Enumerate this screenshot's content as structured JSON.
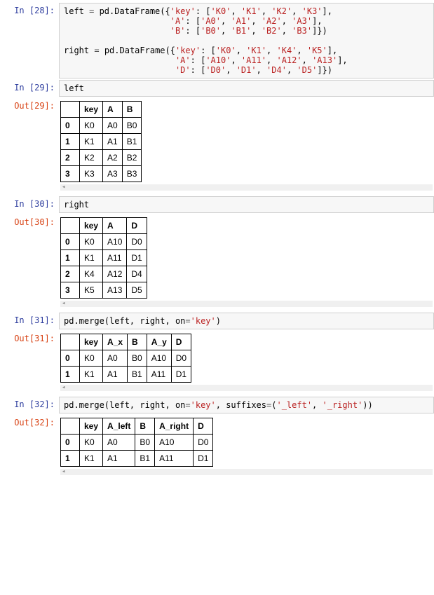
{
  "cells": [
    {
      "type": "code",
      "in_prompt": "In  [28]:",
      "code_html": "left <span class='op'>=</span> pd.DataFrame({<span class='s'>'key'</span>: [<span class='s'>'K0'</span>, <span class='s'>'K1'</span>, <span class='s'>'K2'</span>, <span class='s'>'K3'</span>],\n                     <span class='s'>'A'</span>: [<span class='s'>'A0'</span>, <span class='s'>'A1'</span>, <span class='s'>'A2'</span>, <span class='s'>'A3'</span>],\n                     <span class='s'>'B'</span>: [<span class='s'>'B0'</span>, <span class='s'>'B1'</span>, <span class='s'>'B2'</span>, <span class='s'>'B3'</span>]})\n\nright <span class='op'>=</span> pd.DataFrame({<span class='s'>'key'</span>: [<span class='s'>'K0'</span>, <span class='s'>'K1'</span>, <span class='s'>'K4'</span>, <span class='s'>'K5'</span>],\n                      <span class='s'>'A'</span>: [<span class='s'>'A10'</span>, <span class='s'>'A11'</span>, <span class='s'>'A12'</span>, <span class='s'>'A13'</span>],\n                      <span class='s'>'D'</span>: [<span class='s'>'D0'</span>, <span class='s'>'D1'</span>, <span class='s'>'D4'</span>, <span class='s'>'D5'</span>]})"
    },
    {
      "type": "code_out",
      "in_prompt": "In  [29]:",
      "code_html": "left",
      "out_prompt": "Out[29]:",
      "table": {
        "columns": [
          "key",
          "A",
          "B"
        ],
        "index": [
          "0",
          "1",
          "2",
          "3"
        ],
        "data": [
          [
            "K0",
            "A0",
            "B0"
          ],
          [
            "K1",
            "A1",
            "B1"
          ],
          [
            "K2",
            "A2",
            "B2"
          ],
          [
            "K3",
            "A3",
            "B3"
          ]
        ]
      }
    },
    {
      "type": "code_out",
      "in_prompt": "In  [30]:",
      "code_html": "right",
      "out_prompt": "Out[30]:",
      "table": {
        "columns": [
          "key",
          "A",
          "D"
        ],
        "index": [
          "0",
          "1",
          "2",
          "3"
        ],
        "data": [
          [
            "K0",
            "A10",
            "D0"
          ],
          [
            "K1",
            "A11",
            "D1"
          ],
          [
            "K4",
            "A12",
            "D4"
          ],
          [
            "K5",
            "A13",
            "D5"
          ]
        ]
      }
    },
    {
      "type": "code_out",
      "in_prompt": "In  [31]:",
      "code_html": "pd.merge(left, right, on<span class='op'>=</span><span class='s'>'key'</span>)",
      "out_prompt": "Out[31]:",
      "table": {
        "columns": [
          "key",
          "A_x",
          "B",
          "A_y",
          "D"
        ],
        "index": [
          "0",
          "1"
        ],
        "data": [
          [
            "K0",
            "A0",
            "B0",
            "A10",
            "D0"
          ],
          [
            "K1",
            "A1",
            "B1",
            "A11",
            "D1"
          ]
        ]
      }
    },
    {
      "type": "code_out",
      "in_prompt": "In  [32]:",
      "code_html": "pd.merge(left, right, on<span class='op'>=</span><span class='s'>'key'</span>, suffixes<span class='op'>=</span>(<span class='s'>'_left'</span>, <span class='s'>'_right'</span>))",
      "out_prompt": "Out[32]:",
      "table": {
        "columns": [
          "key",
          "A_left",
          "B",
          "A_right",
          "D"
        ],
        "index": [
          "0",
          "1"
        ],
        "data": [
          [
            "K0",
            "A0",
            "B0",
            "A10",
            "D0"
          ],
          [
            "K1",
            "A1",
            "B1",
            "A11",
            "D1"
          ]
        ]
      }
    }
  ]
}
